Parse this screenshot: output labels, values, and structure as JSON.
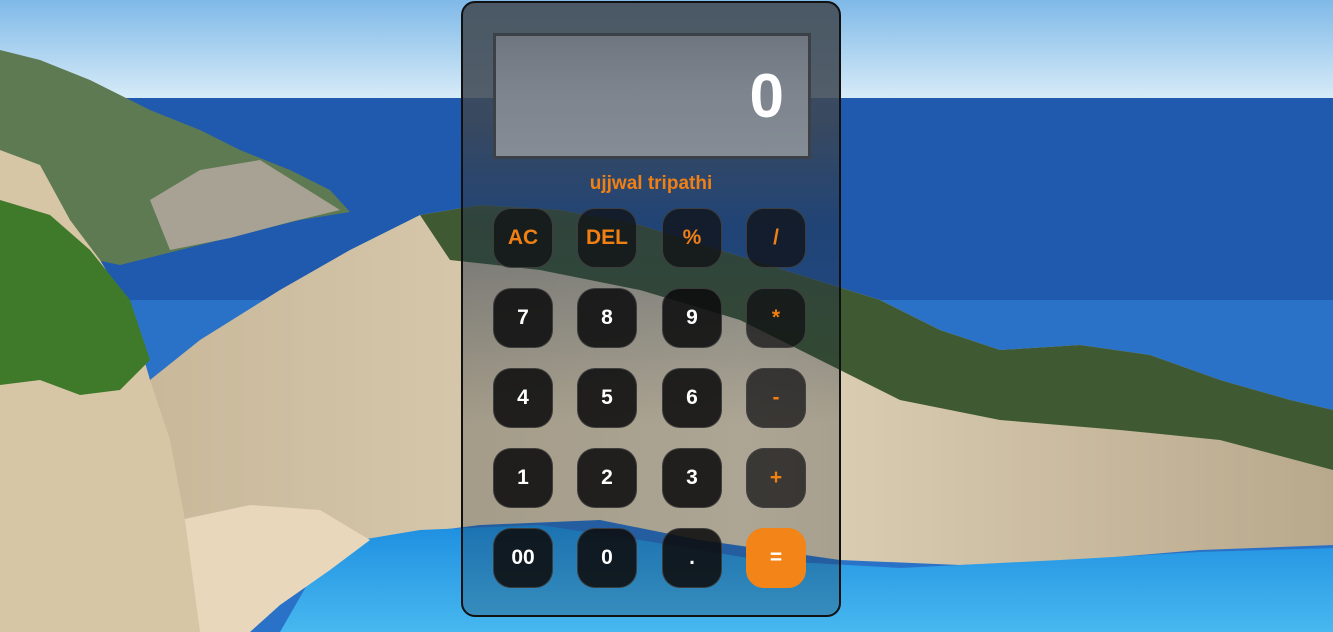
{
  "calculator": {
    "display_value": "0",
    "author": "ujjwal tripathi",
    "accent_color": "#f07f14",
    "rows": [
      [
        {
          "label": "AC",
          "name": "clear-button",
          "kind": "op"
        },
        {
          "label": "DEL",
          "name": "delete-button",
          "kind": "op"
        },
        {
          "label": "%",
          "name": "percent-button",
          "kind": "op"
        },
        {
          "label": "/",
          "name": "divide-button",
          "kind": "op"
        }
      ],
      [
        {
          "label": "7",
          "name": "digit-7-button",
          "kind": "num"
        },
        {
          "label": "8",
          "name": "digit-8-button",
          "kind": "num"
        },
        {
          "label": "9",
          "name": "digit-9-button",
          "kind": "num"
        },
        {
          "label": "*",
          "name": "multiply-button",
          "kind": "op"
        }
      ],
      [
        {
          "label": "4",
          "name": "digit-4-button",
          "kind": "num"
        },
        {
          "label": "5",
          "name": "digit-5-button",
          "kind": "num"
        },
        {
          "label": "6",
          "name": "digit-6-button",
          "kind": "num"
        },
        {
          "label": "-",
          "name": "subtract-button",
          "kind": "op"
        }
      ],
      [
        {
          "label": "1",
          "name": "digit-1-button",
          "kind": "num"
        },
        {
          "label": "2",
          "name": "digit-2-button",
          "kind": "num"
        },
        {
          "label": "3",
          "name": "digit-3-button",
          "kind": "num"
        },
        {
          "label": "+",
          "name": "add-button",
          "kind": "op"
        }
      ],
      [
        {
          "label": "00",
          "name": "double-zero-button",
          "kind": "num"
        },
        {
          "label": "0",
          "name": "digit-0-button",
          "kind": "num"
        },
        {
          "label": ".",
          "name": "decimal-button",
          "kind": "num"
        },
        {
          "label": "=",
          "name": "equals-button",
          "kind": "eq"
        }
      ]
    ]
  }
}
